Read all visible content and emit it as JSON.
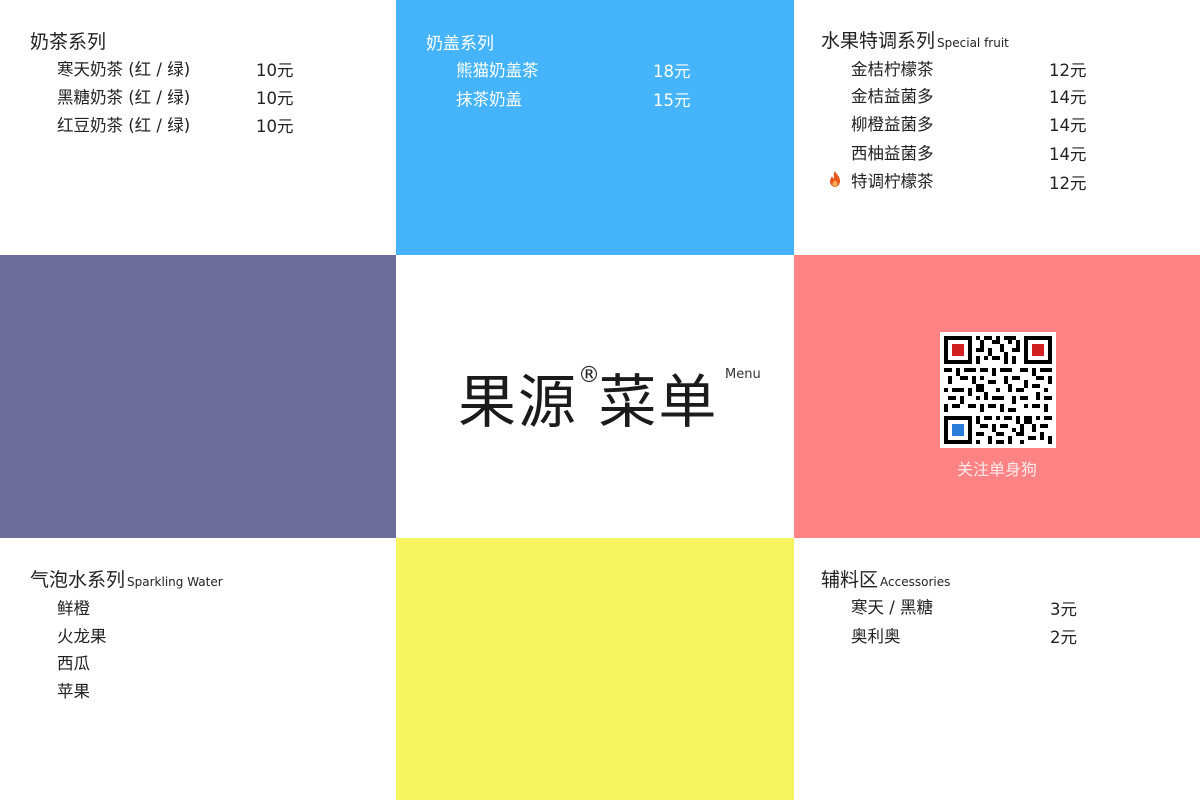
{
  "milk_tea": {
    "title": "奶茶系列",
    "items": [
      {
        "name": "寒天奶茶 (红 / 绿)",
        "price": "10元"
      },
      {
        "name": "黑糖奶茶 (红 / 绿)",
        "price": "10元"
      },
      {
        "name": "红豆奶茶 (红 / 绿)",
        "price": "10元"
      }
    ]
  },
  "cream": {
    "title": "奶盖系列",
    "items": [
      {
        "name": "熊猫奶盖茶",
        "price": "18元"
      },
      {
        "name": "抹茶奶盖",
        "price": "15元"
      }
    ]
  },
  "fruit": {
    "title": "水果特调系列",
    "subtitle": "Special fruit",
    "items": [
      {
        "name": "金桔柠檬茶",
        "price": "12元"
      },
      {
        "name": "金桔益菌多",
        "price": "14元"
      },
      {
        "name": "柳橙益菌多",
        "price": "14元"
      },
      {
        "name": "西柚益菌多",
        "price": "14元"
      },
      {
        "name": "特调柠檬茶",
        "price": "12元",
        "icon": "fire-icon"
      }
    ]
  },
  "logo": {
    "main": "果源 菜单",
    "registered": "®",
    "menu": "Menu"
  },
  "qr": {
    "caption": "关注单身狗"
  },
  "sparkling": {
    "title": "气泡水系列",
    "subtitle": "Sparkling Water",
    "items": [
      "鲜橙",
      "火龙果",
      "西瓜",
      "苹果"
    ]
  },
  "accessories": {
    "title": "辅料区",
    "subtitle": "Accessories",
    "items": [
      {
        "name": "寒天 / 黑糖",
        "price": "3元"
      },
      {
        "name": "奥利奥",
        "price": "2元"
      }
    ]
  },
  "colors": {
    "blue": "#45b4fc",
    "purple": "#6e6c9b",
    "salmon": "#ff8384",
    "yellow": "#f7f45f",
    "fire": "#e8581f"
  }
}
